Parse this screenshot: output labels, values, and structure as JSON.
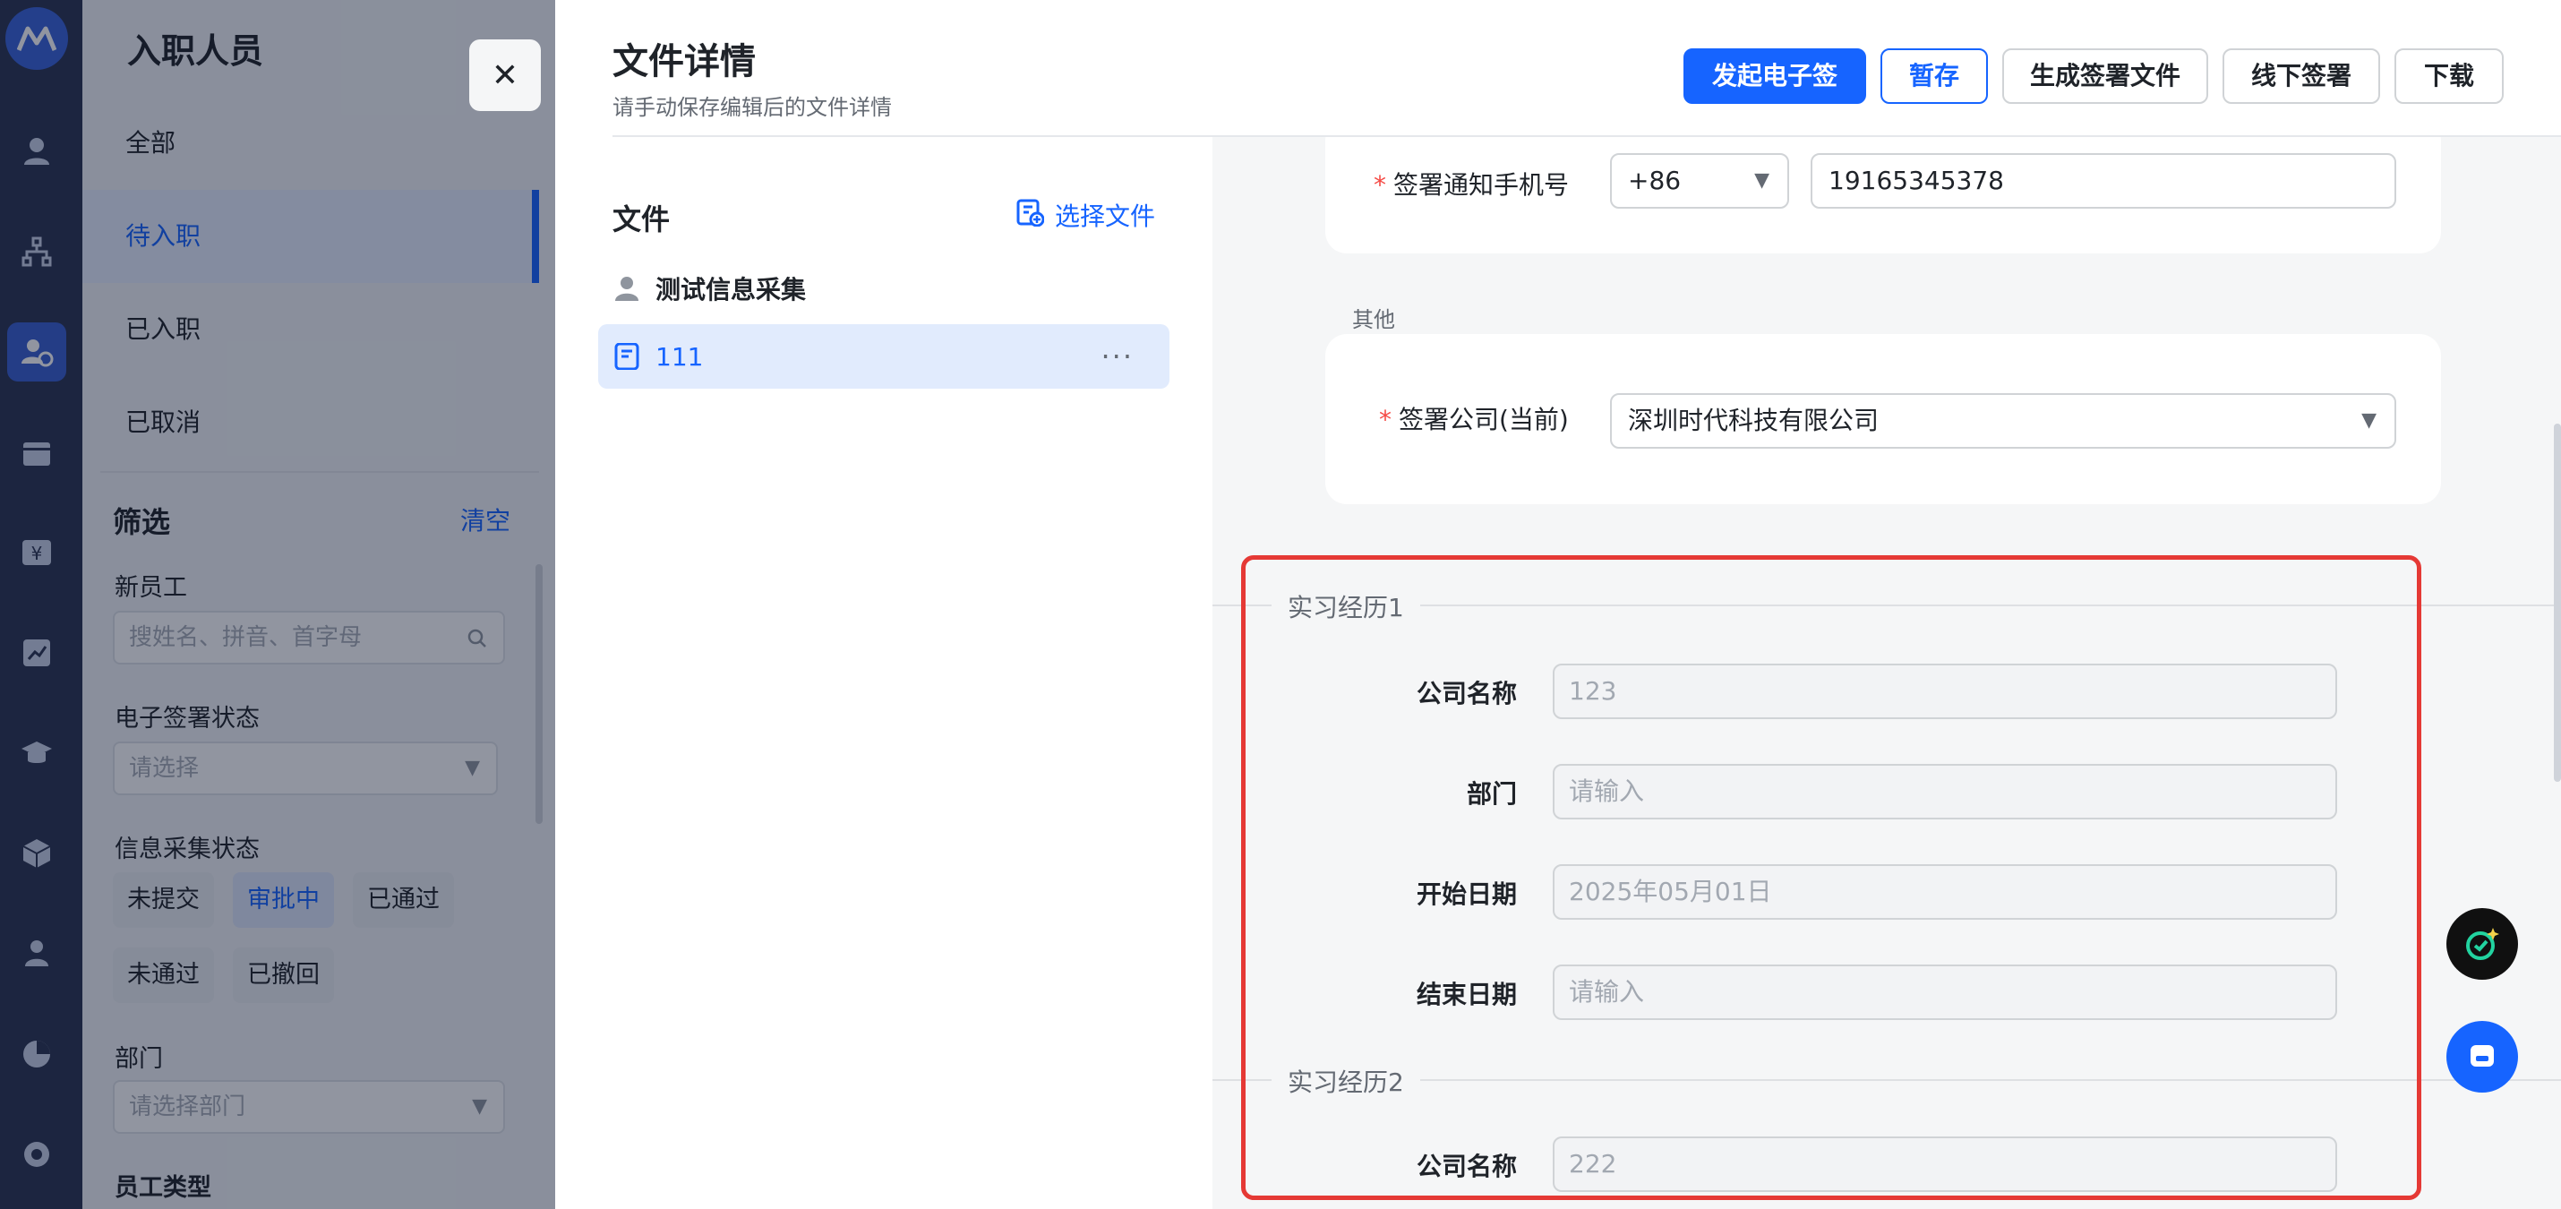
{
  "sidebar_list": {
    "title": "入职人员",
    "statuses": [
      "全部",
      "待入职",
      "已入职",
      "已取消"
    ],
    "active_status": "待入职",
    "filter": {
      "title": "筛选",
      "clear": "清空",
      "new_employee_label": "新员工",
      "new_employee_placeholder": "搜姓名、拼音、首字母",
      "esign_label": "电子签署状态",
      "esign_placeholder": "请选择",
      "collect_label": "信息采集状态",
      "collect_chips": [
        "未提交",
        "审批中",
        "已通过",
        "未通过",
        "已撤回"
      ],
      "dept_label": "部门",
      "dept_placeholder": "请选择部门",
      "type_label": "员工类型"
    }
  },
  "drawer": {
    "title": "文件详情",
    "subtitle": "请手动保存编辑后的文件详情",
    "buttons": {
      "start_esign": "发起电子签",
      "save_draft": "暂存",
      "generate": "生成签署文件",
      "offline": "线下签署",
      "download": "下载"
    },
    "files_title": "文件",
    "select_file": "选择文件",
    "files": [
      {
        "name": "测试信息采集"
      },
      {
        "name": "111",
        "more": "···"
      }
    ]
  },
  "form": {
    "phone_label": "签署通知手机号",
    "country_code": "+86",
    "phone": "19165345378",
    "other_group": "其他",
    "company_label": "签署公司(当前)",
    "company_value": "深圳时代科技有限公司",
    "internships": [
      {
        "legend": "实习经历1",
        "company_label": "公司名称",
        "company": "123",
        "dept_label": "部门",
        "dept_placeholder": "请输入",
        "start_label": "开始日期",
        "start": "2025年05月01日",
        "end_label": "结束日期",
        "end_placeholder": "请输入"
      },
      {
        "legend": "实习经历2",
        "company_label": "公司名称",
        "company": "222"
      }
    ]
  },
  "colors": {
    "accent": "#1664ff",
    "highlight": "#e53935",
    "required": "#f54a45"
  }
}
